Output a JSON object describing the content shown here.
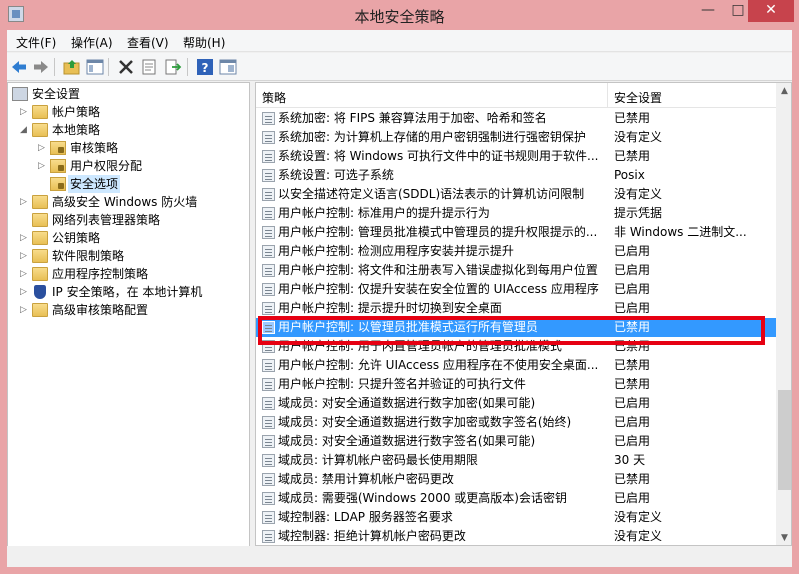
{
  "window": {
    "title": "本地安全策略",
    "minimize": "—",
    "maximize": "□",
    "close": "✕"
  },
  "menu": [
    "文件(F)",
    "操作(A)",
    "查看(V)",
    "帮助(H)"
  ],
  "toolbar_icons": [
    "back-arrow-icon",
    "forward-arrow-icon",
    "up-folder-icon",
    "show-tree-icon",
    "delete-icon",
    "properties-icon",
    "export-icon",
    "help-icon",
    "view-icon"
  ],
  "tree": [
    {
      "label": "安全设置",
      "level": 0,
      "expander": "",
      "icon": "computer"
    },
    {
      "label": "帐户策略",
      "level": 1,
      "expander": "▷",
      "icon": "folder"
    },
    {
      "label": "本地策略",
      "level": 1,
      "expander": "◢",
      "icon": "folder"
    },
    {
      "label": "审核策略",
      "level": 2,
      "expander": "▷",
      "icon": "folder-lock"
    },
    {
      "label": "用户权限分配",
      "level": 2,
      "expander": "▷",
      "icon": "folder-lock"
    },
    {
      "label": "安全选项",
      "level": 2,
      "expander": "",
      "icon": "folder-lock",
      "selected": true
    },
    {
      "label": "高级安全 Windows 防火墙",
      "level": 1,
      "expander": "▷",
      "icon": "folder"
    },
    {
      "label": "网络列表管理器策略",
      "level": 1,
      "expander": "",
      "icon": "folder"
    },
    {
      "label": "公钥策略",
      "level": 1,
      "expander": "▷",
      "icon": "folder"
    },
    {
      "label": "软件限制策略",
      "level": 1,
      "expander": "▷",
      "icon": "folder"
    },
    {
      "label": "应用程序控制策略",
      "level": 1,
      "expander": "▷",
      "icon": "folder"
    },
    {
      "label": "IP 安全策略，在 本地计算机",
      "level": 1,
      "expander": "▷",
      "icon": "shield"
    },
    {
      "label": "高级审核策略配置",
      "level": 1,
      "expander": "▷",
      "icon": "folder"
    }
  ],
  "list": {
    "columns": [
      "策略",
      "安全设置"
    ],
    "rows": [
      {
        "name": "系统加密: 将 FIPS 兼容算法用于加密、哈希和签名",
        "value": "已禁用"
      },
      {
        "name": "系统加密: 为计算机上存储的用户密钥强制进行强密钥保护",
        "value": "没有定义"
      },
      {
        "name": "系统设置: 将 Windows 可执行文件中的证书规则用于软件...",
        "value": "已禁用"
      },
      {
        "name": "系统设置: 可选子系统",
        "value": "Posix"
      },
      {
        "name": "以安全描述符定义语言(SDDL)语法表示的计算机访问限制",
        "value": "没有定义"
      },
      {
        "name": "用户帐户控制: 标准用户的提升提示行为",
        "value": "提示凭据"
      },
      {
        "name": "用户帐户控制: 管理员批准模式中管理员的提升权限提示的...",
        "value": "非 Windows 二进制文..."
      },
      {
        "name": "用户帐户控制: 检测应用程序安装并提示提升",
        "value": "已启用"
      },
      {
        "name": "用户帐户控制: 将文件和注册表写入错误虚拟化到每用户位置",
        "value": "已启用"
      },
      {
        "name": "用户帐户控制: 仅提升安装在安全位置的 UIAccess 应用程序",
        "value": "已启用"
      },
      {
        "name": "用户帐户控制: 提示提升时切换到安全桌面",
        "value": "已启用"
      },
      {
        "name": "用户帐户控制: 以管理员批准模式运行所有管理员",
        "value": "已禁用",
        "selected": true
      },
      {
        "name": "用户帐户控制: 用于内置管理员帐户的管理员批准模式",
        "value": "已禁用"
      },
      {
        "name": "用户帐户控制: 允许 UIAccess 应用程序在不使用安全桌面...",
        "value": "已禁用"
      },
      {
        "name": "用户帐户控制: 只提升签名并验证的可执行文件",
        "value": "已禁用"
      },
      {
        "name": "域成员: 对安全通道数据进行数字加密(如果可能)",
        "value": "已启用"
      },
      {
        "name": "域成员: 对安全通道数据进行数字加密或数字签名(始终)",
        "value": "已启用"
      },
      {
        "name": "域成员: 对安全通道数据进行数字签名(如果可能)",
        "value": "已启用"
      },
      {
        "name": "域成员: 计算机帐户密码最长使用期限",
        "value": "30 天"
      },
      {
        "name": "域成员: 禁用计算机帐户密码更改",
        "value": "已禁用"
      },
      {
        "name": "域成员: 需要强(Windows 2000 或更高版本)会话密钥",
        "value": "已启用"
      },
      {
        "name": "域控制器: LDAP 服务器签名要求",
        "value": "没有定义"
      },
      {
        "name": "域控制器: 拒绝计算机帐户密码更改",
        "value": "没有定义"
      }
    ]
  },
  "colors": {
    "title_bg": "#e9a4a7",
    "selection": "#3399ff",
    "highlight_box": "#e60012"
  }
}
